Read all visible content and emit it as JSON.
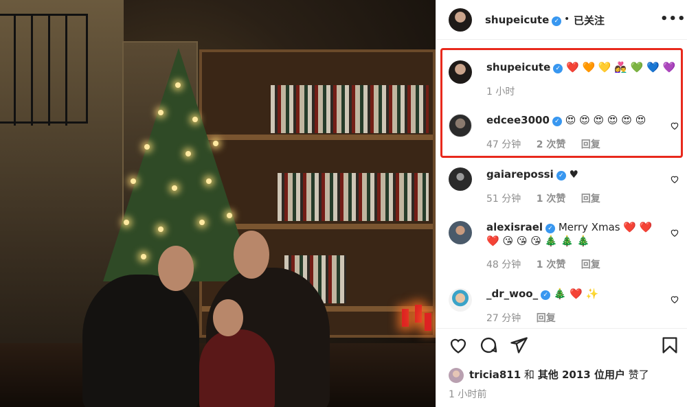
{
  "header": {
    "username": "shupeicute",
    "separator": "•",
    "follow_status": "已关注",
    "more_label": "•••"
  },
  "comments": [
    {
      "username": "shupeicute",
      "text": "❤️ 🧡 💛 👩‍❤️‍👨 💚 💙 💜",
      "time": "1 小时",
      "likes": "",
      "reply": ""
    },
    {
      "username": "edcee3000",
      "text": "😍 😍 😍 😍 😍 😍",
      "time": "47 分钟",
      "likes": "2 次赞",
      "reply": "回复"
    },
    {
      "username": "gaiarepossi",
      "text": "♥",
      "time": "51 分钟",
      "likes": "1 次赞",
      "reply": "回复"
    },
    {
      "username": "alexisrael",
      "text": "Merry Xmas ❤️ ❤️",
      "text2": "❤️ 😘 😘 😘 🎄 🎄 🎄",
      "time": "48 分钟",
      "likes": "1 次赞",
      "reply": "回复"
    },
    {
      "username": "_dr_woo_",
      "text": "🎄 ❤️ ✨",
      "time": "27 分钟",
      "likes": "",
      "reply": "回复"
    }
  ],
  "liked_by": {
    "user": "tricia811",
    "connector": "和",
    "others": "其他 2013 位用户",
    "suffix": "赞了"
  },
  "post_time": "1 小时前",
  "colors": {
    "highlight_box": "#e8291c",
    "verified": "#3897f0",
    "meta_text": "#8e8e8e"
  },
  "icons": [
    "verified-badge-icon",
    "heart-icon",
    "comment-icon",
    "share-icon",
    "bookmark-icon",
    "more-icon"
  ]
}
